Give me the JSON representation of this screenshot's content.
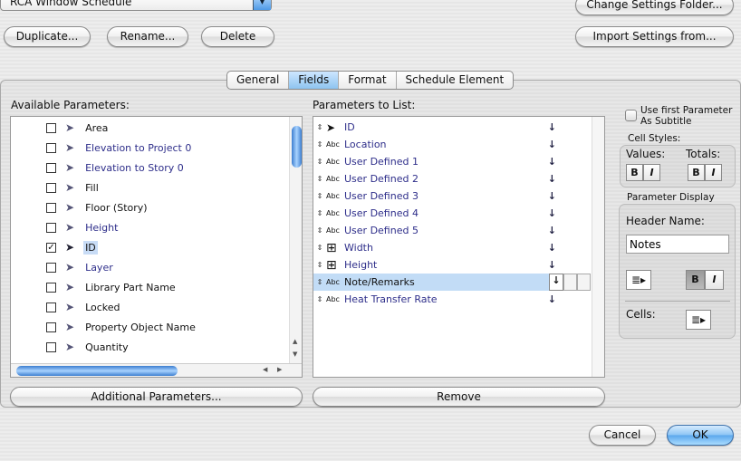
{
  "header": {
    "schedule_select": "RCA Window Schedule",
    "change_folder": "Change Settings Folder...",
    "import_settings": "Import Settings from...",
    "duplicate": "Duplicate...",
    "rename": "Rename...",
    "delete": "Delete"
  },
  "tabs": [
    {
      "label": "General",
      "active": false
    },
    {
      "label": "Fields",
      "active": true
    },
    {
      "label": "Format",
      "active": false
    },
    {
      "label": "Schedule Element",
      "active": false
    }
  ],
  "available": {
    "title": "Available Parameters:",
    "items": [
      {
        "label": "Area",
        "checked": false,
        "blue": false
      },
      {
        "label": "Elevation to Project 0",
        "checked": false,
        "blue": true
      },
      {
        "label": "Elevation to Story 0",
        "checked": false,
        "blue": true
      },
      {
        "label": "Fill",
        "checked": false,
        "blue": false
      },
      {
        "label": "Floor (Story)",
        "checked": false,
        "blue": false
      },
      {
        "label": "Height",
        "checked": false,
        "blue": true
      },
      {
        "label": "ID",
        "checked": true,
        "blue": false,
        "selected": true
      },
      {
        "label": "Layer",
        "checked": false,
        "blue": true
      },
      {
        "label": "Library Part Name",
        "checked": false,
        "blue": false
      },
      {
        "label": "Locked",
        "checked": false,
        "blue": false
      },
      {
        "label": "Property Object Name",
        "checked": false,
        "blue": false
      },
      {
        "label": "Quantity",
        "checked": false,
        "blue": false
      }
    ],
    "additional_button": "Additional Parameters..."
  },
  "to_list": {
    "title": "Parameters to List:",
    "items": [
      {
        "label": "ID",
        "icon": "cursor"
      },
      {
        "label": "Location",
        "icon": "Abc"
      },
      {
        "label": "User Defined 1",
        "icon": "Abc"
      },
      {
        "label": "User Defined 2",
        "icon": "Abc"
      },
      {
        "label": "User Defined 3",
        "icon": "Abc"
      },
      {
        "label": "User Defined 4",
        "icon": "Abc"
      },
      {
        "label": "User Defined 5",
        "icon": "Abc"
      },
      {
        "label": "Width",
        "icon": "window"
      },
      {
        "label": "Height",
        "icon": "window"
      },
      {
        "label": "Note/Remarks",
        "icon": "Abc",
        "selected": true
      },
      {
        "label": "Heat Transfer Rate",
        "icon": "Abc"
      }
    ],
    "remove_button": "Remove"
  },
  "options": {
    "use_first": "Use first Parameter",
    "as_subtitle": "As Subtitle",
    "cell_styles": "Cell Styles:",
    "values": "Values:",
    "totals": "Totals:",
    "bold": "B",
    "italic": "I",
    "param_display": "Parameter Display",
    "header_name": "Header Name:",
    "header_value": "Notes",
    "cells": "Cells:"
  },
  "footer": {
    "cancel": "Cancel",
    "ok": "OK"
  }
}
